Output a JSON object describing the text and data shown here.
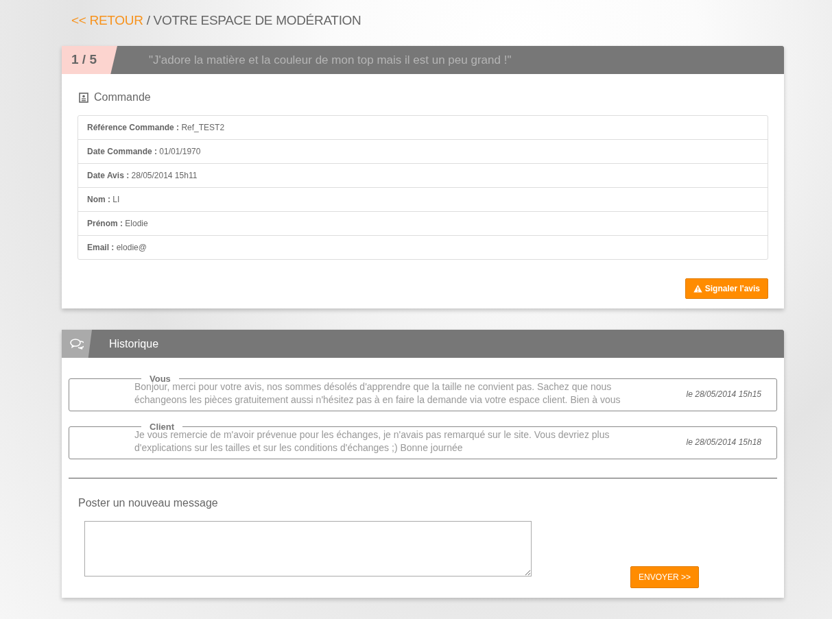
{
  "breadcrumb": {
    "back_link": "<< RETOUR",
    "separator": "/",
    "title": "VOTRE ESPACE DE MODÉRATION"
  },
  "review": {
    "counter": "1 / 5",
    "quote": "\"J'adore la matière et la couleur de mon top mais il est un peu grand !\"",
    "section_title": "Commande",
    "fields": [
      {
        "label": "Référence Commande :",
        "value": "Ref_TEST2"
      },
      {
        "label": "Date Commande :",
        "value": "01/01/1970"
      },
      {
        "label": "Date Avis :",
        "value": "28/05/2014 15h11"
      },
      {
        "label": "Nom :",
        "value": "LI"
      },
      {
        "label": "Prénom :",
        "value": "Elodie"
      },
      {
        "label": "Email :",
        "value": "elodie@"
      }
    ],
    "report_button": "Signaler l'avis"
  },
  "history": {
    "title": "Historique",
    "messages": [
      {
        "author": "Vous",
        "text": "Bonjour, merci pour votre avis, nos sommes désolés d'apprendre que la taille ne convient pas. Sachez que nous échangeons les pièces gratuitement aussi n'hésitez pas à en faire la demande via votre espace client. Bien à vous",
        "date": "le 28/05/2014 15h15"
      },
      {
        "author": "Client",
        "text": "Je vous remercie de m'avoir prévenue pour les échanges, je n'avais pas remarqué sur le site. Vous devriez plus d'explications sur les tailles et sur les conditions d'échanges ;)  Bonne journée",
        "date": "le 28/05/2014 15h18"
      }
    ],
    "new_message_label": "Poster un nouveau message",
    "send_button": "ENVOYER >>"
  }
}
